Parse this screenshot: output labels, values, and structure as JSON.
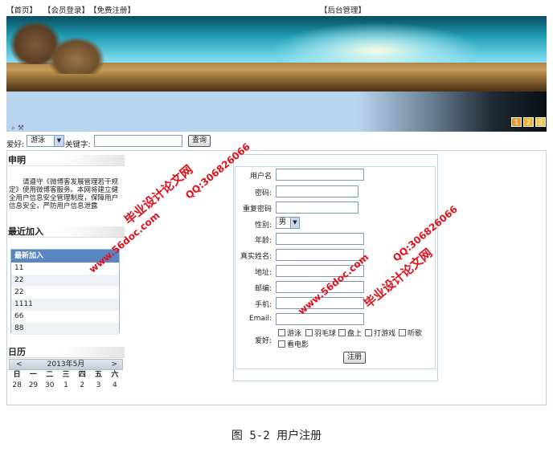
{
  "topnav": {
    "home": "【首页】",
    "member_login": "【会员登录】",
    "free_register": "【免费注册】",
    "admin": "【后台管理】"
  },
  "banner": {
    "slides": [
      "1",
      "2",
      "3"
    ]
  },
  "search": {
    "hobby_label": "爱好:",
    "hobby_selected": "游泳",
    "keyword_label": "关键字:",
    "keyword_value": "",
    "query_label": "查询"
  },
  "sidebar": {
    "notice_title": "申明",
    "notice_text": "请遵守《微博客发展管理若干规定》使用微博客服务。本网将建立健全用户信息安全管理制度，保障用户信息安全，严防用户信息泄露",
    "recent_title": "最近加入",
    "recent_header": "最新加入",
    "recent_items": [
      "11",
      "22",
      "22",
      "1111",
      "66",
      "88"
    ],
    "calendar_title": "日历",
    "calendar_month": "2013年5月",
    "calendar_prev": "<",
    "calendar_next": ">",
    "weekdays": [
      "日",
      "一",
      "二",
      "三",
      "四",
      "五",
      "六"
    ],
    "days_row1": [
      "28",
      "29",
      "30",
      "1",
      "2",
      "3",
      "4"
    ]
  },
  "register_form": {
    "username_label": "用户名",
    "password_label": "密码:",
    "confirm_label": "重复密码",
    "sex_label": "性别:",
    "sex_selected": "男",
    "age_label": "年龄:",
    "realname_label": "真实姓名:",
    "address_label": "地址:",
    "zip_label": "邮编:",
    "phone_label": "手机:",
    "email_label": "Email:",
    "hobby_label": "爱好:",
    "hobbies": [
      "游泳",
      "羽毛球",
      "盘上",
      "打游戏",
      "听歌",
      "看电影"
    ],
    "submit_label": "注册"
  },
  "watermarks": {
    "brand": "毕业设计论文网",
    "site": "www.56doc.com",
    "qq": "QQ:306826066"
  },
  "caption": "图 5-2 用户注册"
}
